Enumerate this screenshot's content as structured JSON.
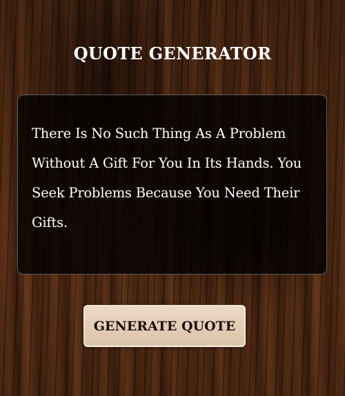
{
  "header": {
    "title": "QUOTE GENERATOR"
  },
  "quote": {
    "text": "There Is No Such Thing As A Problem Without A Gift For You In Its Hands. You Seek Problems Because You Need Their Gifts."
  },
  "actions": {
    "generate_label": "GENERATE QUOTE"
  }
}
